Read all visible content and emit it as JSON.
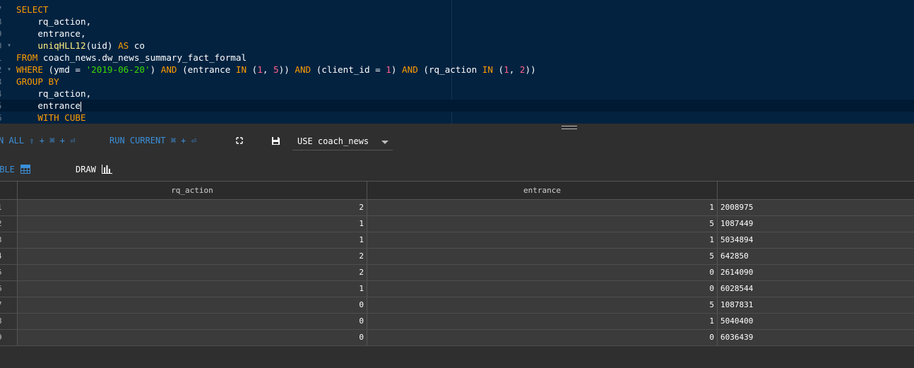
{
  "editor": {
    "lines": [
      {
        "ln": "7",
        "segments": [
          {
            "t": "SELECT",
            "c": "kw"
          }
        ]
      },
      {
        "ln": "8",
        "segments": [
          {
            "t": "    rq_action,",
            "c": ""
          }
        ]
      },
      {
        "ln": "9",
        "segments": [
          {
            "t": "    entrance,",
            "c": ""
          }
        ]
      },
      {
        "ln": "0",
        "fold": true,
        "segments": [
          {
            "t": "    ",
            "c": ""
          },
          {
            "t": "uniqHLL12",
            "c": "fn"
          },
          {
            "t": "(uid) ",
            "c": ""
          },
          {
            "t": "AS",
            "c": "kw"
          },
          {
            "t": " co",
            "c": ""
          }
        ]
      },
      {
        "ln": "1",
        "segments": [
          {
            "t": "FROM",
            "c": "kw"
          },
          {
            "t": " coach_news.dw_news_summary_fact_formal",
            "c": ""
          }
        ]
      },
      {
        "ln": "2",
        "fold": true,
        "segments": [
          {
            "t": "WHERE",
            "c": "kw"
          },
          {
            "t": " (ymd = ",
            "c": ""
          },
          {
            "t": "'2019-06-20'",
            "c": "str"
          },
          {
            "t": ") ",
            "c": ""
          },
          {
            "t": "AND",
            "c": "kw"
          },
          {
            "t": " (entrance ",
            "c": ""
          },
          {
            "t": "IN",
            "c": "kw"
          },
          {
            "t": " (",
            "c": ""
          },
          {
            "t": "1",
            "c": "num"
          },
          {
            "t": ", ",
            "c": ""
          },
          {
            "t": "5",
            "c": "num"
          },
          {
            "t": ")) ",
            "c": ""
          },
          {
            "t": "AND",
            "c": "kw"
          },
          {
            "t": " (client_id = ",
            "c": ""
          },
          {
            "t": "1",
            "c": "num"
          },
          {
            "t": ") ",
            "c": ""
          },
          {
            "t": "AND",
            "c": "kw"
          },
          {
            "t": " (rq_action ",
            "c": ""
          },
          {
            "t": "IN",
            "c": "kw"
          },
          {
            "t": " (",
            "c": ""
          },
          {
            "t": "1",
            "c": "num"
          },
          {
            "t": ", ",
            "c": ""
          },
          {
            "t": "2",
            "c": "num"
          },
          {
            "t": "))",
            "c": ""
          }
        ]
      },
      {
        "ln": "3",
        "segments": [
          {
            "t": "GROUP BY",
            "c": "kw"
          }
        ]
      },
      {
        "ln": "4",
        "segments": [
          {
            "t": "    rq_action,",
            "c": ""
          }
        ]
      },
      {
        "ln": "5",
        "active": true,
        "cursor": true,
        "segments": [
          {
            "t": "    entrance",
            "c": ""
          }
        ]
      },
      {
        "ln": "6",
        "segments": [
          {
            "t": "    ",
            "c": ""
          },
          {
            "t": "WITH CUBE",
            "c": "kw"
          }
        ]
      }
    ]
  },
  "toolbar": {
    "run_all_label": "N ALL ⇧ + ⌘ + ⏎",
    "run_current_label": "RUN CURRENT ⌘ + ⏎",
    "database_select_value": "USE coach_news"
  },
  "tabs": {
    "table_label": "ABLE",
    "draw_label": "DRAW"
  },
  "grid": {
    "columns": [
      "rq_action",
      "entrance",
      ""
    ],
    "rows": [
      [
        "1",
        "2",
        "1",
        "2008975"
      ],
      [
        "2",
        "1",
        "5",
        "1087449"
      ],
      [
        "3",
        "1",
        "1",
        "5034894"
      ],
      [
        "4",
        "2",
        "5",
        "642850"
      ],
      [
        "5",
        "2",
        "0",
        "2614090"
      ],
      [
        "6",
        "1",
        "0",
        "6028544"
      ],
      [
        "7",
        "0",
        "5",
        "1087831"
      ],
      [
        "8",
        "0",
        "1",
        "5040400"
      ],
      [
        "9",
        "0",
        "0",
        "6036439"
      ]
    ]
  }
}
